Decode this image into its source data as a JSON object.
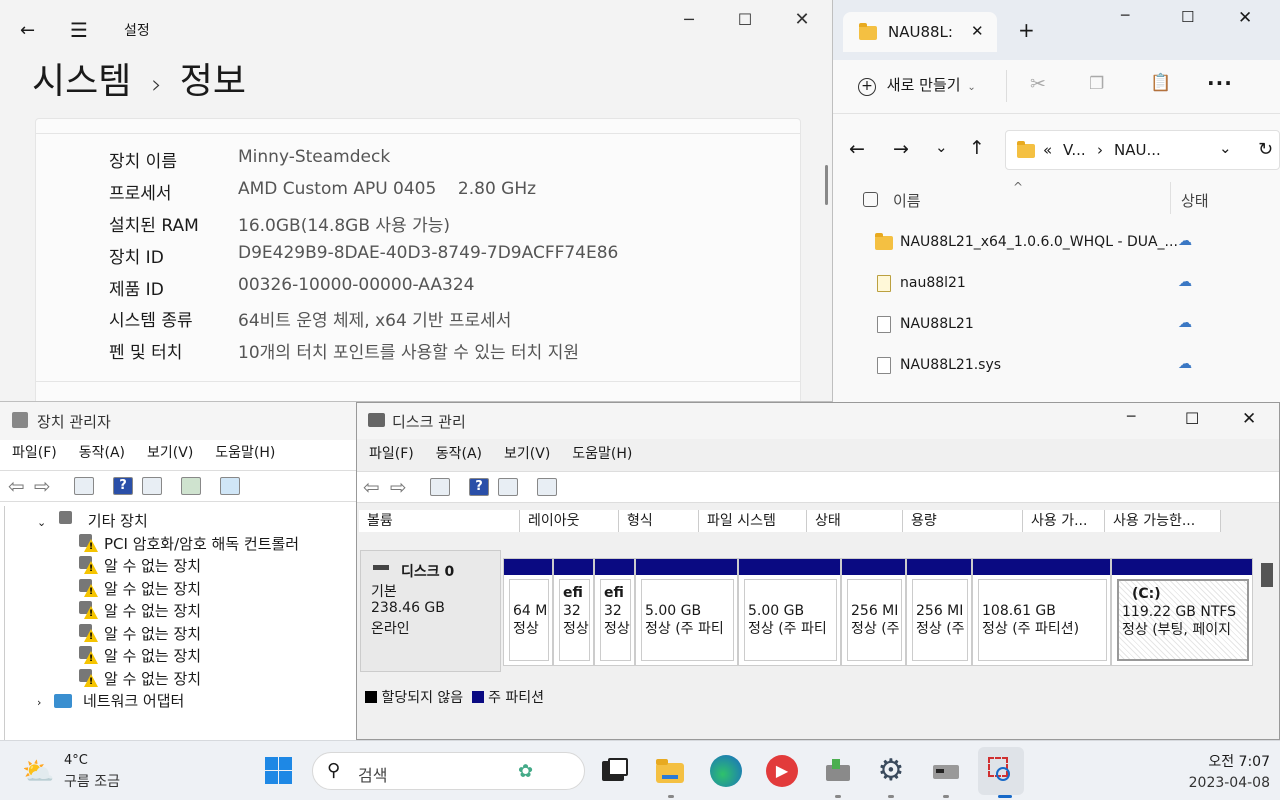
{
  "settings": {
    "window_title": "설정",
    "breadcrumb_parent": "시스템",
    "breadcrumb_current": "정보",
    "specs": [
      {
        "key": "장치 이름",
        "value": "Minny-Steamdeck"
      },
      {
        "key": "프로세서",
        "value": "AMD Custom APU 0405    2.80 GHz"
      },
      {
        "key": "설치된 RAM",
        "value": "16.0GB(14.8GB 사용 가능)"
      },
      {
        "key": "장치 ID",
        "value": "D9E429B9-8DAE-40D3-8749-7D9ACFF74E86"
      },
      {
        "key": "제품 ID",
        "value": "00326-10000-00000-AA324"
      },
      {
        "key": "시스템 종류",
        "value": "64비트 운영 체제, x64 기반 프로세서"
      },
      {
        "key": "펜 및 터치",
        "value": "10개의 터치 포인트를 사용할 수 있는 터치 지원"
      }
    ]
  },
  "explorer": {
    "tab_title": "NAU88L:",
    "new_label": "새로 만들기",
    "path_prefix": "«",
    "path_1": "V...",
    "path_2": "NAU...",
    "col_name": "이름",
    "col_status": "상태",
    "files": [
      {
        "name": "NAU88L21_x64_1.0.6.0_WHQL - DUA_...",
        "type": "folder"
      },
      {
        "name": "nau88l21",
        "type": "inf"
      },
      {
        "name": "NAU88L21",
        "type": "cat"
      },
      {
        "name": "NAU88L21.sys",
        "type": "sys"
      }
    ]
  },
  "devmgr": {
    "title": "장치 관리자",
    "menus": [
      "파일(F)",
      "동작(A)",
      "보기(V)",
      "도움말(H)"
    ],
    "category": "기타 장치",
    "devices": [
      "PCI 암호화/암호 해독 컨트롤러",
      "알 수 없는 장치",
      "알 수 없는 장치",
      "알 수 없는 장치",
      "알 수 없는 장치",
      "알 수 없는 장치",
      "알 수 없는 장치"
    ],
    "next_category": "네트워크 어댑터"
  },
  "diskmgr": {
    "title": "디스크 관리",
    "menus": [
      "파일(F)",
      "동작(A)",
      "보기(V)",
      "도움말(H)"
    ],
    "columns": [
      "볼륨",
      "레이아웃",
      "형식",
      "파일 시스템",
      "상태",
      "용량",
      "사용 가...",
      "사용 가능한..."
    ],
    "disk": {
      "name": "디스크 0",
      "type": "기본",
      "size": "238.46 GB",
      "status": "온라인"
    },
    "partitions": [
      {
        "l1": "",
        "l2": "64 M",
        "l3": "정상"
      },
      {
        "l1": "efi",
        "l2": "32",
        "l3": "정상"
      },
      {
        "l1": "efi",
        "l2": "32",
        "l3": "정상"
      },
      {
        "l1": "",
        "l2": "5.00 GB",
        "l3": "정상 (주 파티"
      },
      {
        "l1": "",
        "l2": "5.00 GB",
        "l3": "정상 (주 파티"
      },
      {
        "l1": "",
        "l2": "256 MI",
        "l3": "정상 (주"
      },
      {
        "l1": "",
        "l2": "256 MI",
        "l3": "정상 (주"
      },
      {
        "l1": "",
        "l2": "108.61 GB",
        "l3": "정상 (주 파티션)"
      },
      {
        "l1": "(C:)",
        "l2": "119.22 GB NTFS",
        "l3": "정상 (부팅, 페이지"
      }
    ],
    "legend_unalloc": "할당되지 않음",
    "legend_primary": "주 파티션"
  },
  "taskbar": {
    "weather_temp": "4°C",
    "weather_desc": "구름 조금",
    "search_placeholder": "검색",
    "time": "오전 7:07",
    "date": "2023-04-08"
  }
}
